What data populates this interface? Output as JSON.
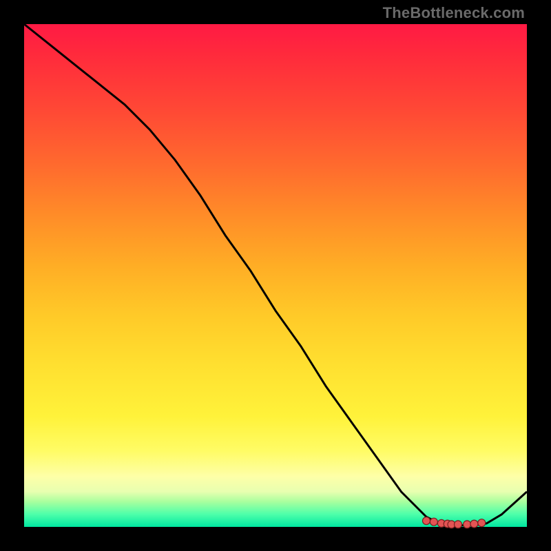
{
  "attribution": "TheBottleneck.com",
  "chart_data": {
    "type": "line",
    "title": "",
    "xlabel": "",
    "ylabel": "",
    "xlim": [
      0,
      100
    ],
    "ylim": [
      0,
      100
    ],
    "series": [
      {
        "name": "bottleneck-curve",
        "x": [
          0,
          5,
          10,
          15,
          20,
          25,
          30,
          35,
          40,
          45,
          50,
          55,
          60,
          65,
          70,
          75,
          80,
          82,
          84,
          86,
          88,
          90,
          92,
          95,
          100
        ],
        "y": [
          100,
          96,
          92,
          88,
          84,
          79,
          73,
          66,
          58,
          51,
          43,
          36,
          28,
          21,
          14,
          7,
          2,
          1,
          0.5,
          0.3,
          0.3,
          0.4,
          0.7,
          2.5,
          7
        ]
      }
    ],
    "markers": {
      "name": "optimal-zone-markers",
      "x": [
        80,
        81.5,
        83,
        84.2,
        85,
        86.3,
        88.1,
        89.5,
        91
      ],
      "y": [
        1.2,
        1.0,
        0.7,
        0.6,
        0.5,
        0.5,
        0.5,
        0.6,
        0.8
      ]
    },
    "colors": {
      "line": "#000000",
      "marker_fill": "#e35454",
      "marker_stroke": "#7a1f1f",
      "gradient_top": "#ff1a44",
      "gradient_bottom": "#00e6a0"
    }
  }
}
